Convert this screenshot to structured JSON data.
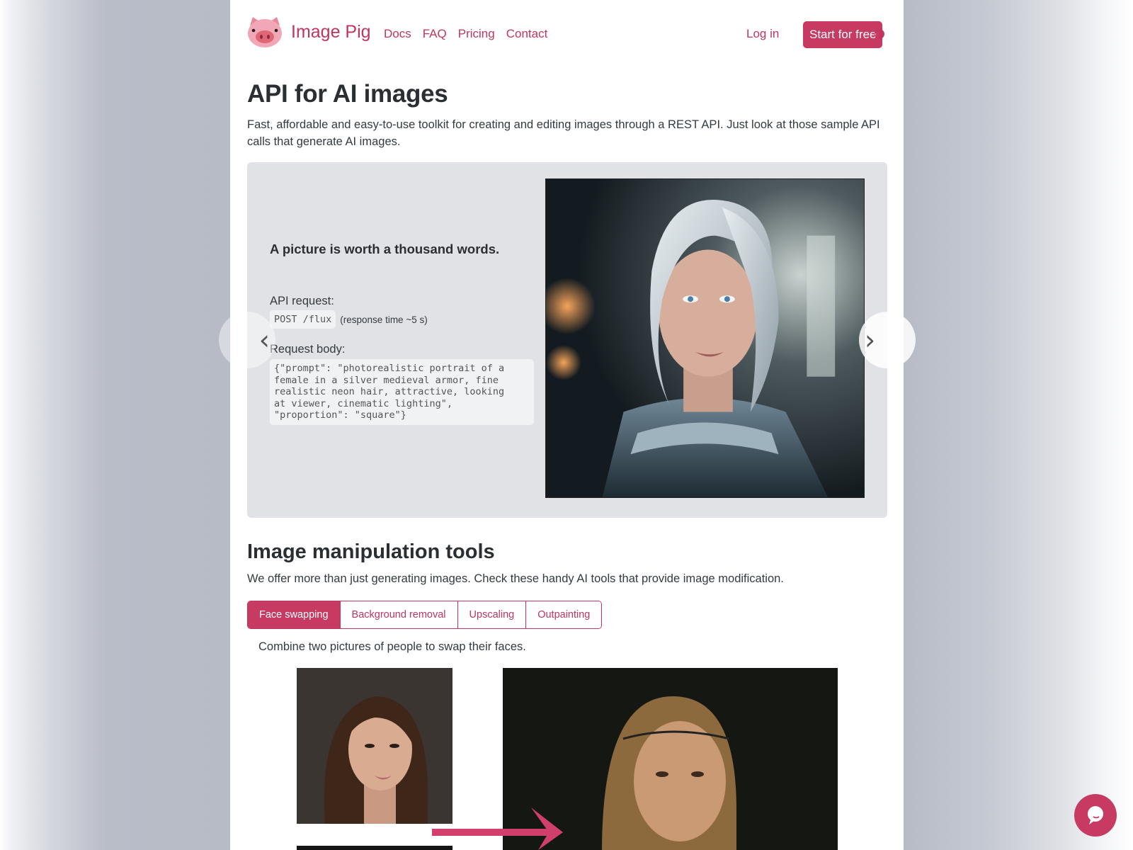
{
  "header": {
    "brand": "Image Pig",
    "logo_icon": "pig-face-icon",
    "nav": [
      "Docs",
      "FAQ",
      "Pricing",
      "Contact"
    ],
    "login_label": "Log in",
    "cta_label": "Start for free",
    "theme_toggle_icon": "half-circle-contrast-icon"
  },
  "hero": {
    "title": "API for AI images",
    "description": "Fast, affordable and easy-to-use toolkit for creating and editing images through a REST API. Just look at those sample API calls that generate AI images."
  },
  "carousel": {
    "slide_title": "A picture is worth a thousand words.",
    "api_request_label": "API request:",
    "api_endpoint": "POST /flux",
    "response_time": "(response time ~5 s)",
    "request_body_label": "Request body:",
    "request_body": "{\"prompt\": \"photorealistic portrait of a\nfemale in a silver medieval armor, fine\nrealistic neon hair, attractive, looking\nat viewer, cinematic lighting\",\n\"proportion\": \"square\"}",
    "image_alt": "AI portrait of a woman with silver hair in medieval armor",
    "prev_icon": "‹",
    "next_icon": "›"
  },
  "tools": {
    "title": "Image manipulation tools",
    "description": "We offer more than just generating images. Check these handy AI tools that provide image modification.",
    "tabs": [
      {
        "label": "Face swapping",
        "active": true
      },
      {
        "label": "Background removal",
        "active": false
      },
      {
        "label": "Upscaling",
        "active": false
      },
      {
        "label": "Outpainting",
        "active": false
      }
    ],
    "active_description": "Combine two pictures of people to swap their faces."
  },
  "colors": {
    "accent": "#c73a62",
    "link": "#c0355e",
    "carousel_bg": "#e0e2e6",
    "text": "#343a40"
  },
  "chat": {
    "icon": "chat-bubble-icon"
  }
}
